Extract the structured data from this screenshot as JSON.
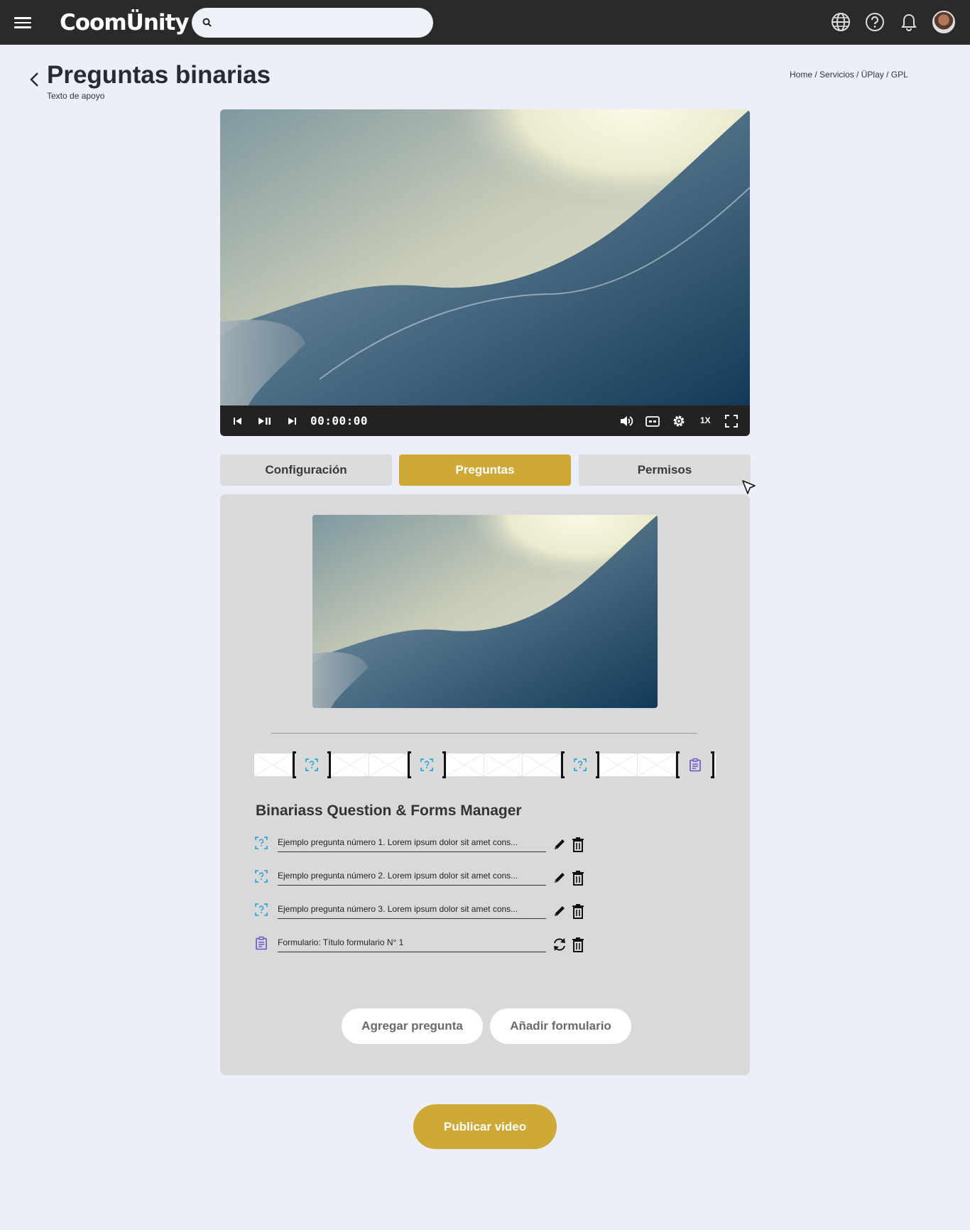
{
  "app": {
    "logo_text": "CoomÜnity",
    "search_placeholder": ""
  },
  "header": {
    "title": "Preguntas binarias",
    "subtitle": "Texto de apoyo",
    "breadcrumb": [
      "Home",
      "Servicios",
      "ÜPlay",
      "GPL"
    ]
  },
  "player": {
    "timecode": "00:00:00",
    "speed": "1X"
  },
  "tabs": [
    {
      "label": "Configuración",
      "active": false
    },
    {
      "label": "Preguntas",
      "active": true
    },
    {
      "label": "Permisos",
      "active": false
    }
  ],
  "manager": {
    "title": "Binariass Question & Forms Manager",
    "items": [
      {
        "type": "question",
        "text": "Ejemplo pregunta número 1. Lorem ipsum dolor sit amet cons..."
      },
      {
        "type": "question",
        "text": "Ejemplo pregunta número 2. Lorem ipsum dolor sit amet cons..."
      },
      {
        "type": "question",
        "text": "Ejemplo pregunta número 3. Lorem ipsum dolor sit amet cons..."
      },
      {
        "type": "form",
        "text": "Formulario: Título formulario N° 1"
      }
    ]
  },
  "buttons": {
    "add_question": "Agregar pregunta",
    "add_form": "Añadir formulario",
    "publish": "Publicar video"
  },
  "colors": {
    "accent": "#cfa936",
    "topbar": "#2a2a2a",
    "question_icon": "#2ea7d6",
    "form_icon": "#6a4fc9"
  },
  "icons": [
    "menu-icon",
    "search-icon",
    "globe-icon",
    "help-icon",
    "bell-icon",
    "back-icon",
    "skip-previous-icon",
    "play-pause-icon",
    "skip-next-icon",
    "volume-icon",
    "captions-icon",
    "settings-icon",
    "fullscreen-icon",
    "question-icon",
    "form-icon",
    "edit-icon",
    "delete-icon",
    "refresh-icon"
  ]
}
